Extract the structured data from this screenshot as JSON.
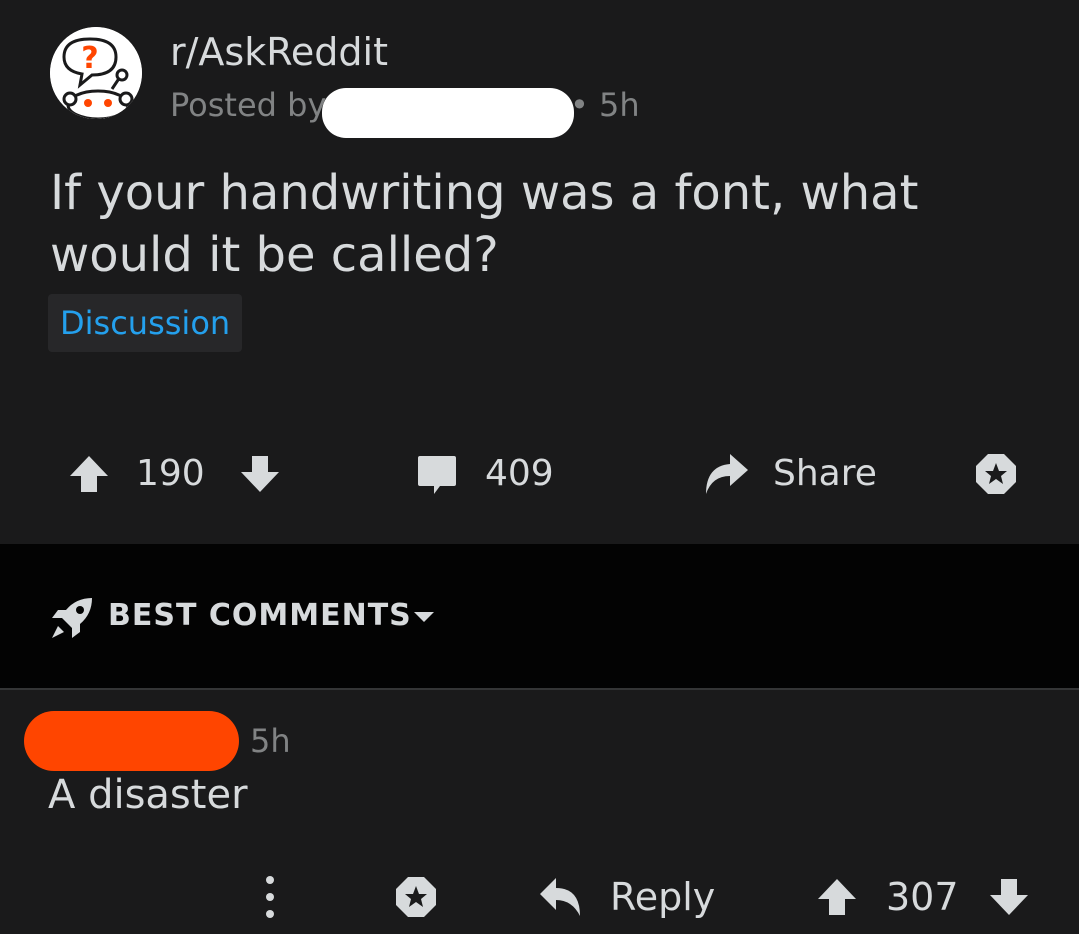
{
  "post": {
    "subreddit": "r/AskReddit",
    "posted_by_prefix": "Posted by",
    "time": "• 5h",
    "title": "If your handwriting was a font, what would it be called?",
    "flair": "Discussion",
    "upvote_count": "190",
    "comment_count": "409",
    "share_label": "Share"
  },
  "sort": {
    "label": "BEST COMMENTS"
  },
  "comment": {
    "time": "5h",
    "body": "A disaster",
    "reply_label": "Reply",
    "score": "307"
  },
  "icons": {
    "avatar": "askreddit-snoo-icon",
    "upvote": "arrow-up-icon",
    "downvote": "arrow-down-icon",
    "comments": "comment-bubble-icon",
    "share": "share-arrow-icon",
    "award": "award-icon",
    "sort": "rocket-icon",
    "dropdown": "caret-down-icon",
    "more": "more-vertical-icon",
    "reply": "reply-arrow-icon"
  },
  "colors": {
    "background": "#1a1a1b",
    "divider_band": "#030303",
    "text": "#d7dadc",
    "muted": "#818384",
    "flair": "#24a0ed",
    "redaction_orange": "#ff4500"
  }
}
